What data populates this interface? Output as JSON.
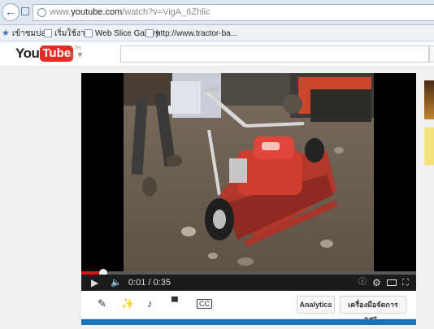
{
  "browser": {
    "url_prefix": "www.",
    "url_domain": "youtube.com",
    "url_path": "/watch?v=VigA_6Zhlic"
  },
  "favorites": [
    {
      "label": "เข้าชมบ่อย",
      "icon": "star-icon"
    },
    {
      "label": "เริ่มใช้งาน",
      "icon": "page-icon"
    },
    {
      "label": "Web Slice Gallery",
      "icon": "page-icon"
    },
    {
      "label": "http://www.tractor-ba...",
      "icon": "page-icon"
    }
  ],
  "youtube": {
    "logo_you": "You",
    "logo_tube": "Tube",
    "logo_country": "TH",
    "guide_icon": "≡ ▾"
  },
  "player": {
    "time_current": "0:01",
    "time_separator": "/",
    "time_total": "0:35",
    "progress_fraction": 0.065
  },
  "actions": {
    "analytics_label": "Analytics",
    "video_manager_label": "เครื่องมือจัดการวิดีโอ"
  },
  "colors": {
    "youtube_red": "#e52d27",
    "progress_red": "#cc181e",
    "link_blue": "#1a73b5"
  }
}
